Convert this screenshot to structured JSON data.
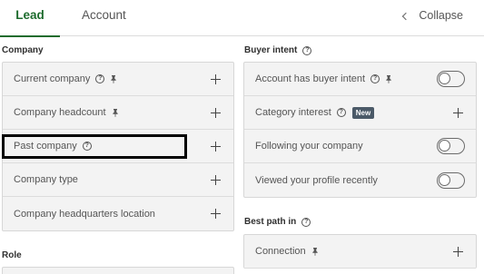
{
  "tabs": {
    "lead": "Lead",
    "account": "Account",
    "collapse": "Collapse"
  },
  "company": {
    "title": "Company",
    "rows": [
      {
        "label": "Current company",
        "help": "?",
        "pinned": true
      },
      {
        "label": "Company headcount",
        "pinned": true
      },
      {
        "label": "Past company",
        "help": "?"
      },
      {
        "label": "Company type"
      },
      {
        "label": "Company headquarters location"
      }
    ]
  },
  "buyer_intent": {
    "title": "Buyer intent",
    "help": "?",
    "rows": [
      {
        "label": "Account has buyer intent",
        "help": "?",
        "pinned": true,
        "control": "toggle",
        "on": false
      },
      {
        "label": "Category interest",
        "help": "?",
        "badge": "New",
        "control": "plus"
      },
      {
        "label": "Following your company",
        "control": "toggle",
        "on": false
      },
      {
        "label": "Viewed your profile recently",
        "control": "toggle",
        "on": false
      }
    ]
  },
  "best_path": {
    "title": "Best path in",
    "help": "?",
    "rows": [
      {
        "label": "Connection",
        "pinned": true
      }
    ]
  },
  "role": {
    "title": "Role"
  },
  "colors": {
    "accent": "#1d6b2d",
    "badge": "#4b5a68"
  }
}
